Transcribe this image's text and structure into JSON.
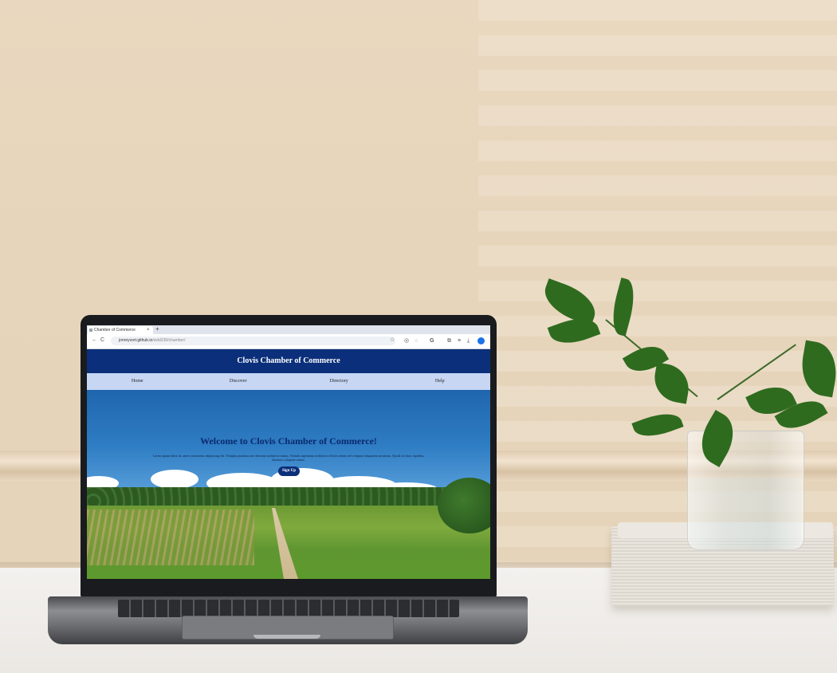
{
  "browser": {
    "tab_title": "Chamber of Commerce",
    "tab_close": "×",
    "new_tab": "+",
    "url_host": "jonreyvort.github.io",
    "url_path": "/wdd230/chamber/",
    "nav_back": "←",
    "nav_reload": "C",
    "star": "☆"
  },
  "site": {
    "title": "Clovis Chamber of Commerce",
    "nav": [
      "Home",
      "Discover",
      "Directory",
      "Help"
    ],
    "hero_title": "Welcome to Clovis Chamber of Commerce!",
    "hero_text": "Lorem ipsum dolor sit, amet consectetur adipisicing elit. Voluptas possimus nec deserunt architecto minus. Veritatis aspernatur architecto officiis omnis sed voluptas voluptatem possimus. Quodi sit vitae, expedita, ducimus voluptate autem.",
    "signup_label": "Sign Up"
  },
  "colors": {
    "header_bg": "#0b2f7a",
    "nav_bg": "#c6d6f3"
  }
}
